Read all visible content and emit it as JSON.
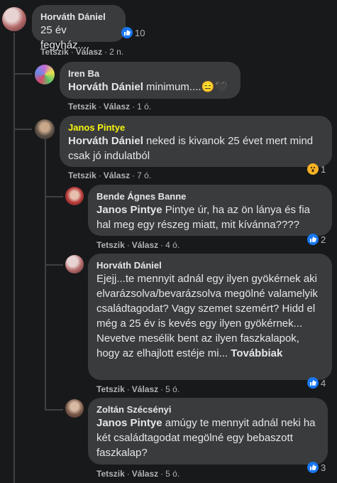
{
  "comments": [
    {
      "author": "Horváth Dániel",
      "text": "25 év fegyház....",
      "actions": {
        "like": "Tetszik",
        "reply": "Válasz",
        "time": "2 n."
      },
      "reaction_count": "10"
    },
    {
      "author": "Iren Ba",
      "mention": "Horváth Dániel",
      "text": " minimum....😑🖤",
      "actions": {
        "like": "Tetszik",
        "reply": "Válasz",
        "time": "1 ó."
      }
    },
    {
      "author": "Janos Pintye",
      "mention": "Horváth Dániel",
      "text": " neked is kivanok 25 évet mert mind csak jó indulatból",
      "actions": {
        "like": "Tetszik",
        "reply": "Válasz",
        "time": "7 ó."
      },
      "reaction_count": "1"
    },
    {
      "author": "Bende Ágnes Banne",
      "mention": "Janos Pintye",
      "text": " Pintye úr, ha az ön lánya és fia hal meg egy részeg miatt, mit kívánna????",
      "actions": {
        "like": "Tetszik",
        "reply": "Válasz",
        "time": "4 ó."
      },
      "reaction_count": "2"
    },
    {
      "author": "Horváth Dániel",
      "text": "Ejejj...te mennyit adnál egy ilyen gyökérnek aki elvarázsolva/bevarázsolva megölné valamelyik családtagodat? Vagy szemet szemért? Hidd el még a 25 év is kevés egy ilyen gyökérnek... Nevetve mesélik bent az ilyen faszkalapok, hogy az elhajlott estéje mi...",
      "more": "Továbbiak",
      "actions": {
        "like": "Tetszik",
        "reply": "Válasz",
        "time": "5 ó."
      },
      "reaction_count": "4"
    },
    {
      "author": "Zoltán Szécsényi",
      "mention": "Janos Pintye",
      "text": " amúgy te mennyit adnál neki ha két családtagodat megölné egy bebaszott faszkalap?",
      "actions": {
        "like": "Tetszik",
        "reply": "Válasz",
        "time": "5 ó."
      },
      "reaction_count": "3"
    }
  ],
  "colors": {
    "background": "#18191a",
    "bubble": "#3a3b3c",
    "text": "#e4e6eb",
    "secondary": "#b0b3b8",
    "highlight_name": "#f5f511",
    "like_blue": "#1877f2"
  },
  "icons": {
    "like": "thumbs-up-icon",
    "wow": "wow-face-icon"
  }
}
